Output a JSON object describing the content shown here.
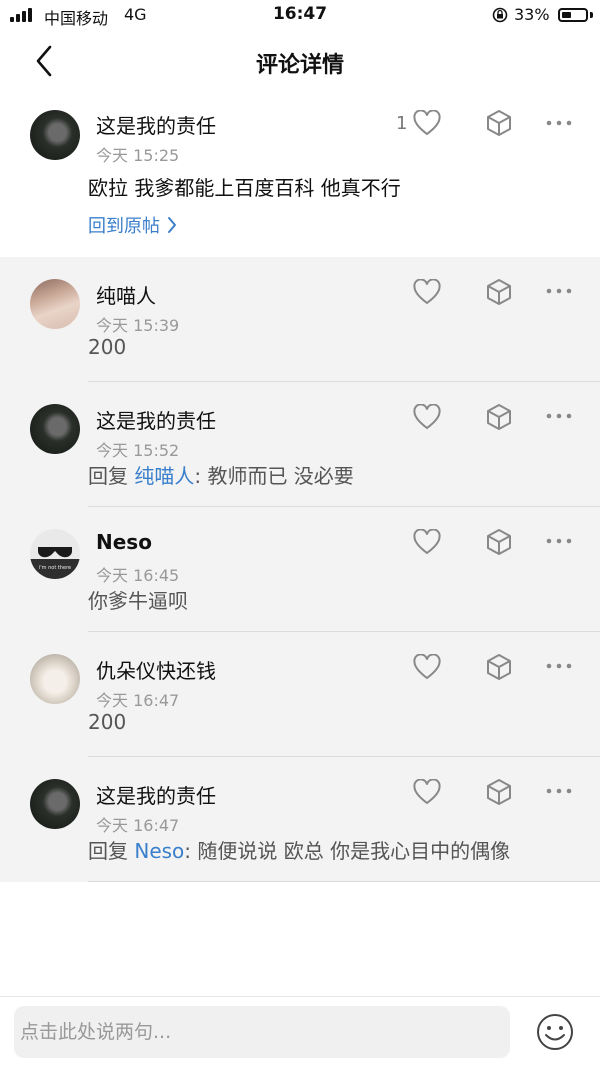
{
  "status_bar": {
    "carrier": "中国移动",
    "network": "4G",
    "time": "16:47",
    "battery_pct": "33%"
  },
  "header": {
    "title": "评论详情"
  },
  "main_comment": {
    "username": "这是我的责任",
    "time": "今天 15:25",
    "text": "欧拉 我爹都能上百度百科 他真不行",
    "like_count": "1",
    "back_to_post": "回到原帖"
  },
  "replies": [
    {
      "username": "纯喵人",
      "time": "今天 15:39",
      "text": "200"
    },
    {
      "username": "这是我的责任",
      "time": "今天 15:52",
      "reply_prefix": "回复 ",
      "mention": "纯喵人",
      "text": ": 教师而已 没必要"
    },
    {
      "username": "Neso",
      "time": "今天 16:45",
      "text": "你爹牛逼呗",
      "avatar_caption": "i'm not there"
    },
    {
      "username": "仇朵仪快还钱",
      "time": "今天 16:47",
      "text": "200"
    },
    {
      "username": "这是我的责任",
      "time": "今天 16:47",
      "reply_prefix": "回复 ",
      "mention": "Neso",
      "text": ": 随便说说 欧总 你是我心目中的偶像"
    }
  ],
  "composer": {
    "placeholder": "点击此处说两句..."
  },
  "icons": {
    "back": "chevron-left-icon",
    "like": "heart-icon",
    "share": "share-cube-icon",
    "more": "ellipsis-icon",
    "emoji": "smiley-icon"
  },
  "colors": {
    "link": "#3a7fcc",
    "reply_bg": "#f3f3f3"
  }
}
